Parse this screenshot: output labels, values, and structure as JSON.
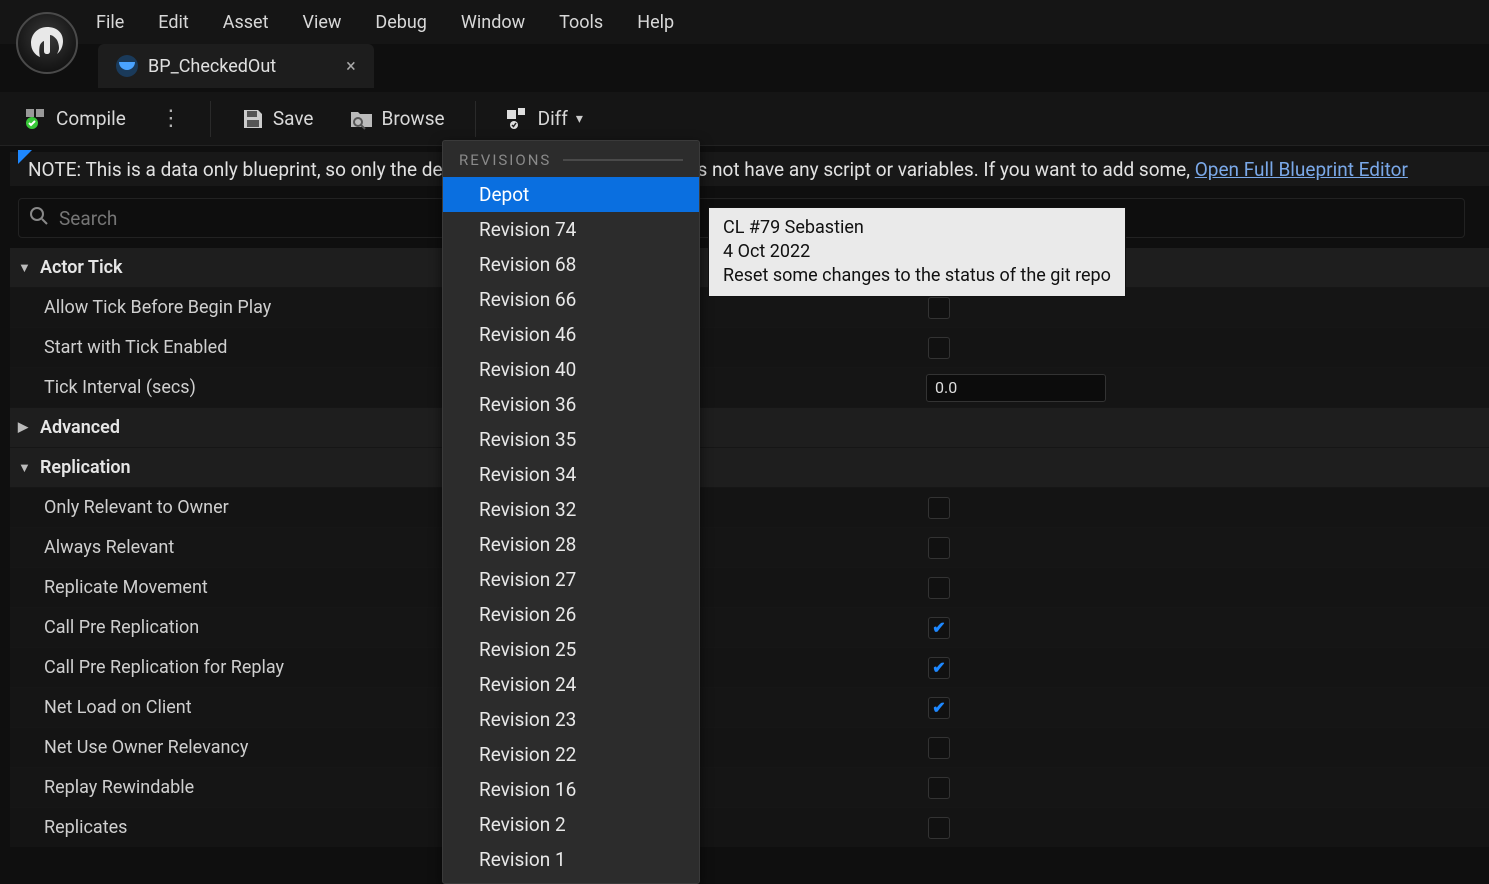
{
  "menu": {
    "items": [
      "File",
      "Edit",
      "Asset",
      "View",
      "Debug",
      "Window",
      "Tools",
      "Help"
    ]
  },
  "tab": {
    "title": "BP_CheckedOut"
  },
  "toolbar": {
    "compile": "Compile",
    "save": "Save",
    "browse": "Browse",
    "diff": "Diff"
  },
  "note": {
    "prefix": "NOTE: This is a data only blueprint, so only the de",
    "suffix": "es not have any script or variables.  If you want to add some, ",
    "link": "Open Full Blueprint Editor"
  },
  "search": {
    "placeholder": "Search"
  },
  "sections": [
    {
      "name": "Actor Tick",
      "expanded": true,
      "props": [
        {
          "label": "Allow Tick Before Begin Play",
          "type": "bool",
          "value": false
        },
        {
          "label": "Start with Tick Enabled",
          "type": "bool",
          "value": false
        },
        {
          "label": "Tick Interval (secs)",
          "type": "float",
          "value": "0.0"
        }
      ]
    },
    {
      "name": "Advanced",
      "expanded": false,
      "props": []
    },
    {
      "name": "Replication",
      "expanded": true,
      "props": [
        {
          "label": "Only Relevant to Owner",
          "type": "bool",
          "value": false
        },
        {
          "label": "Always Relevant",
          "type": "bool",
          "value": false
        },
        {
          "label": "Replicate Movement",
          "type": "bool",
          "value": false
        },
        {
          "label": "Call Pre Replication",
          "type": "bool",
          "value": true
        },
        {
          "label": "Call Pre Replication for Replay",
          "type": "bool",
          "value": true
        },
        {
          "label": "Net Load on Client",
          "type": "bool",
          "value": true
        },
        {
          "label": "Net Use Owner Relevancy",
          "type": "bool",
          "value": false
        },
        {
          "label": "Replay Rewindable",
          "type": "bool",
          "value": false
        },
        {
          "label": "Replicates",
          "type": "bool",
          "value": false
        }
      ]
    }
  ],
  "diff_dropdown": {
    "header": "REVISIONS",
    "items": [
      "Depot",
      "Revision 74",
      "Revision 68",
      "Revision 66",
      "Revision 46",
      "Revision 40",
      "Revision 36",
      "Revision 35",
      "Revision 34",
      "Revision 32",
      "Revision 28",
      "Revision 27",
      "Revision 26",
      "Revision 25",
      "Revision 24",
      "Revision 23",
      "Revision 22",
      "Revision 16",
      "Revision 2",
      "Revision 1"
    ],
    "selected_index": 0
  },
  "tooltip": {
    "line1": "CL #79 Sebastien",
    "line2": "4 Oct 2022",
    "line3": "Reset some changes to the status of the git repo"
  }
}
